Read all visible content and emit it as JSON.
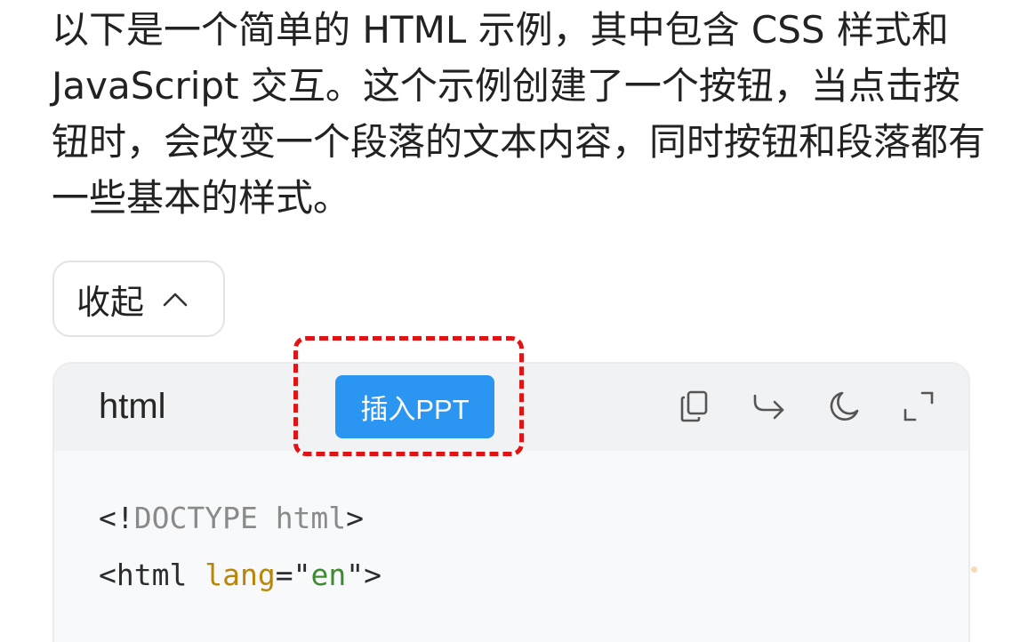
{
  "intro": {
    "text": "以下是一个简单的 HTML 示例，其中包含 CSS 样式和 JavaScript 交互。这个示例创建了一个按钮，当点击按钮时，会改变一个段落的文本内容，同时按钮和段落都有一些基本的样式。"
  },
  "collapse": {
    "label": "收起",
    "icon": "chevron-up-icon"
  },
  "code_block": {
    "language": "html",
    "insert_ppt_label": "插入PPT",
    "toolbar_icons": [
      "copy-icon",
      "redo-icon",
      "moon-icon",
      "expand-icon"
    ],
    "lines": {
      "line1": {
        "open": "<",
        "bang": "!",
        "doctype": "DOCTYPE html",
        "close": ">"
      },
      "line2": {
        "open": "<",
        "tag": "html",
        "space": " ",
        "attr": "lang",
        "eq": "=",
        "quote_open": "\"",
        "value": "en",
        "quote_close": "\"",
        "close": ">"
      }
    }
  },
  "colors": {
    "accent": "#2b95f2",
    "annotation": "#e01414",
    "code_attr": "#b8860b",
    "code_string": "#3d8b2f"
  }
}
